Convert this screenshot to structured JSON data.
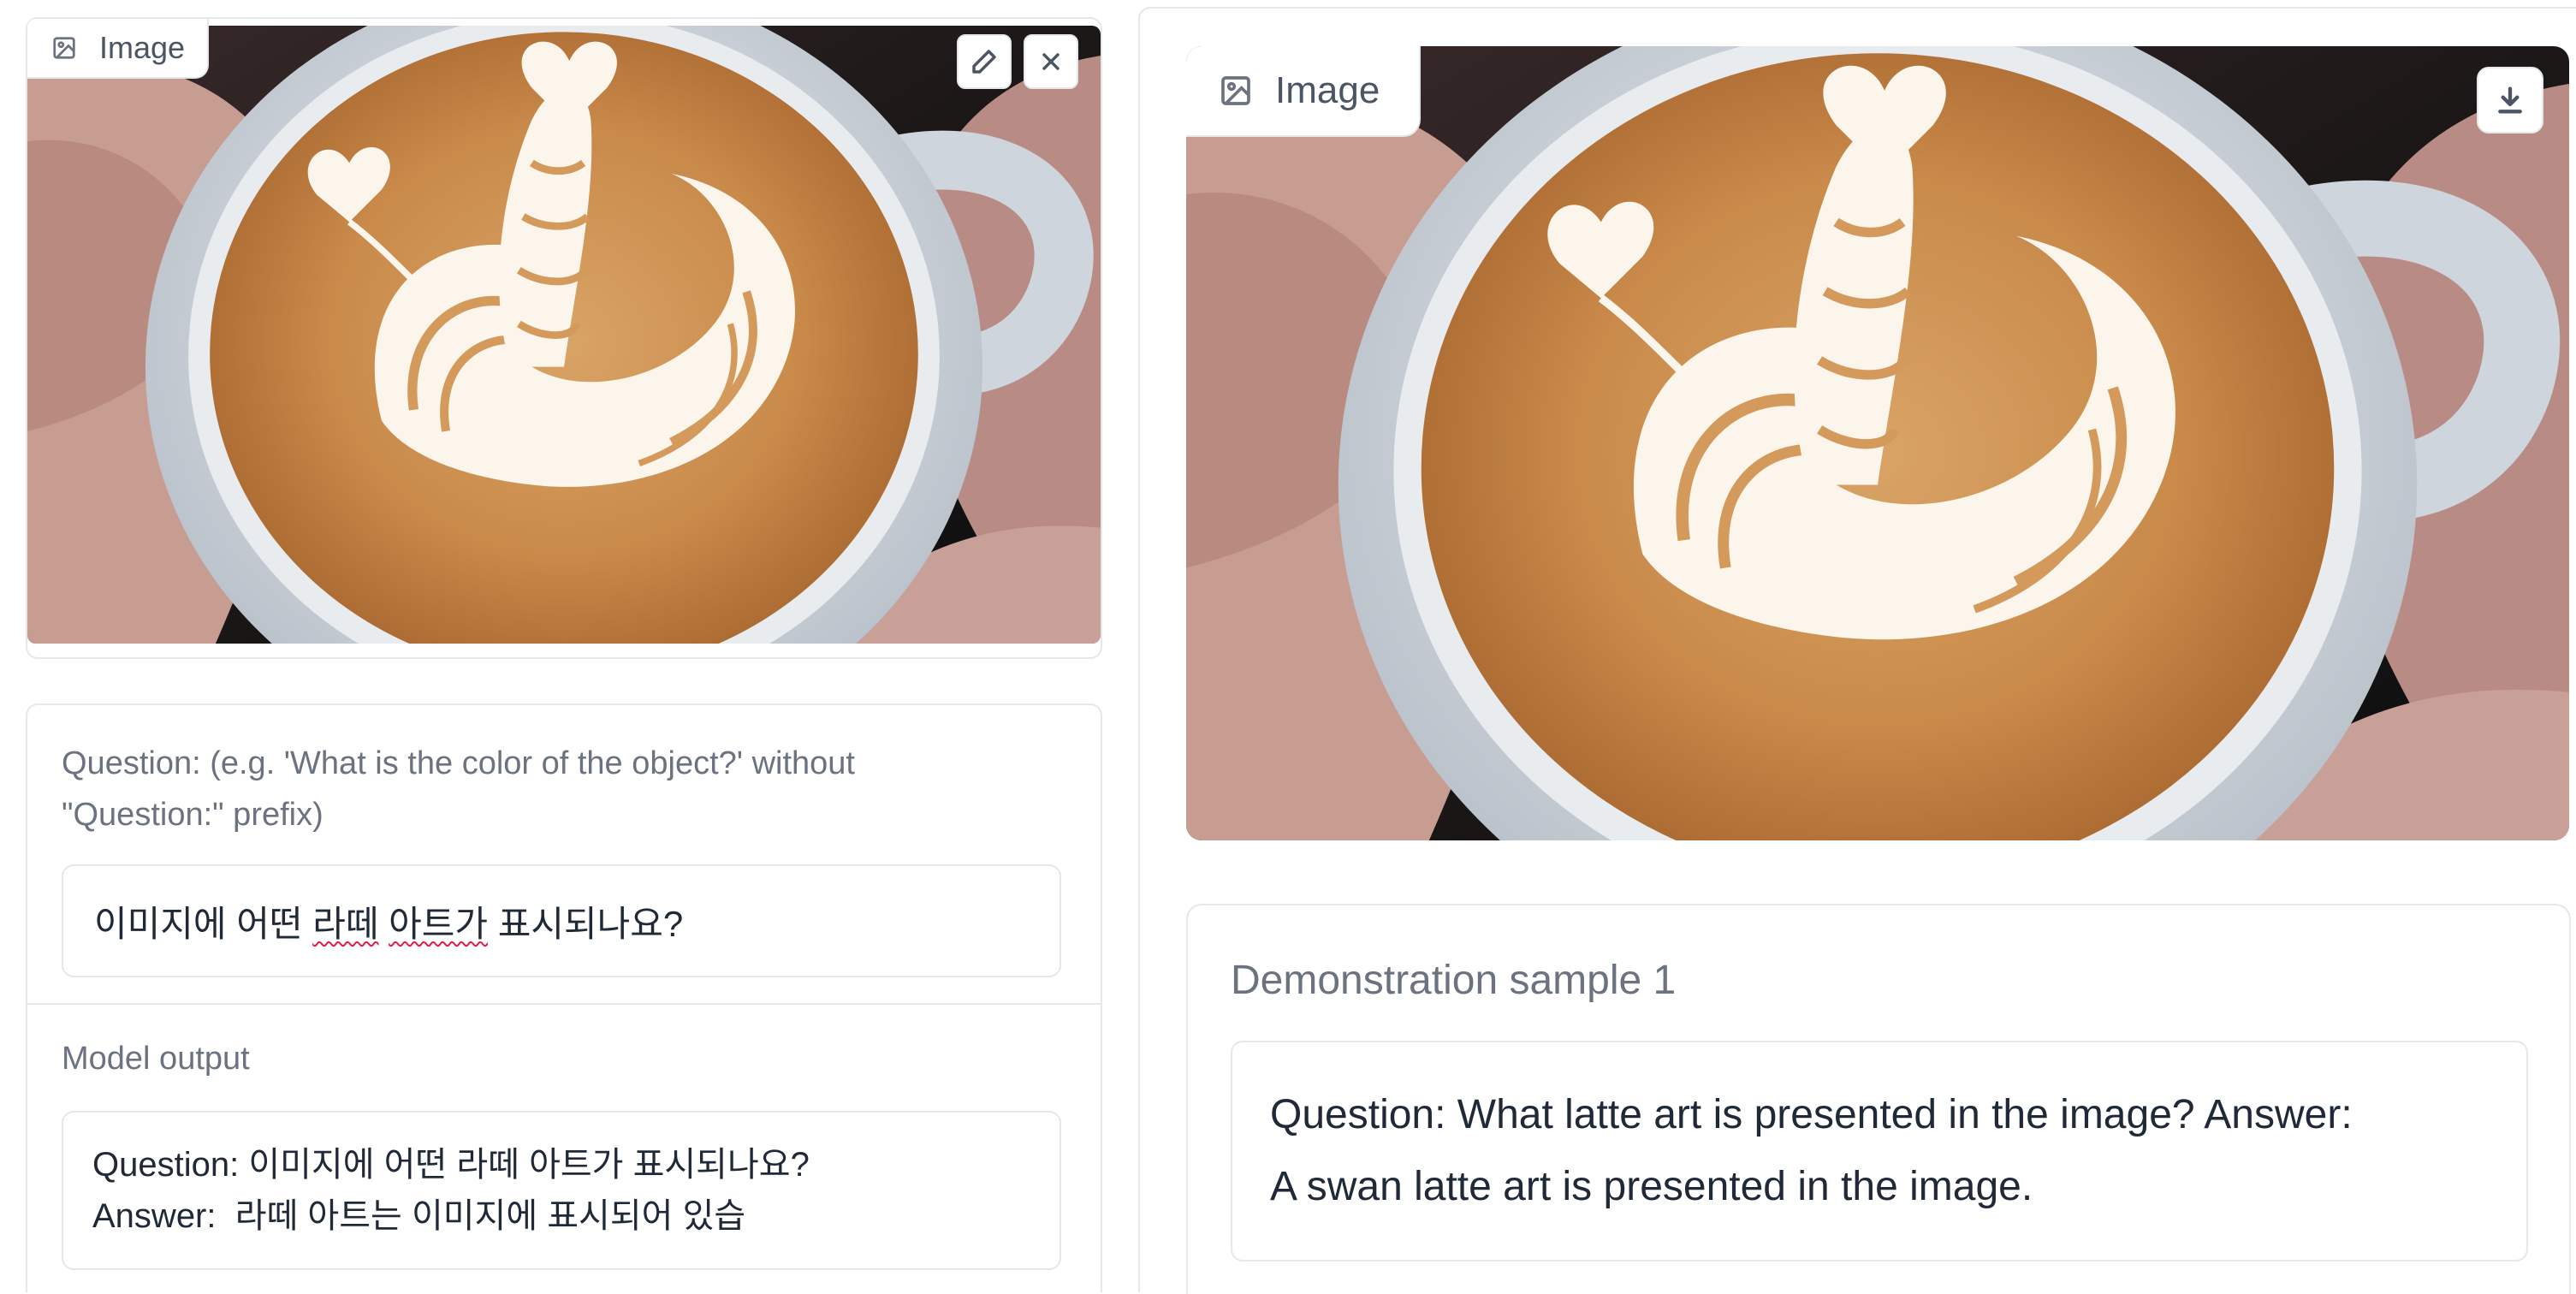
{
  "left": {
    "input_image": {
      "label": "Image",
      "label_icon": "image-icon",
      "actions": [
        "pencil-edit-icon",
        "close-icon"
      ]
    },
    "question": {
      "label": "Question: (e.g. 'What is the color of the object?' without \"Question:\" prefix)",
      "value_prefix": "이미지에 어떤 ",
      "value_misspelled_1": "라떼",
      "value_space": " ",
      "value_misspelled_2": "아트가",
      "value_suffix": " 표시되나요?"
    },
    "model_output": {
      "label": "Model output",
      "line1": "Question: 이미지에 어떤 라떼 아트가 표시되나요?",
      "line2": "Answer:  라떼 아트는 이미지에 표시되어 있습"
    }
  },
  "right": {
    "output_image": {
      "label": "Image",
      "label_icon": "image-icon",
      "actions": [
        "download-icon"
      ]
    },
    "demo": {
      "label": "Demonstration sample 1",
      "line1": "Question: What latte art is presented in the image? Answer:",
      "line2": "A swan latte art is presented in the image."
    }
  },
  "colors": {
    "border": "#e5e7eb",
    "label_text": "#6b7280",
    "body_text": "#1f2937",
    "crema": "#c98a4a",
    "foam": "#fbf5ec",
    "cup": "#dfe3e8",
    "background_dark": "#141414",
    "spellcheck_underline": "#e11d48"
  }
}
